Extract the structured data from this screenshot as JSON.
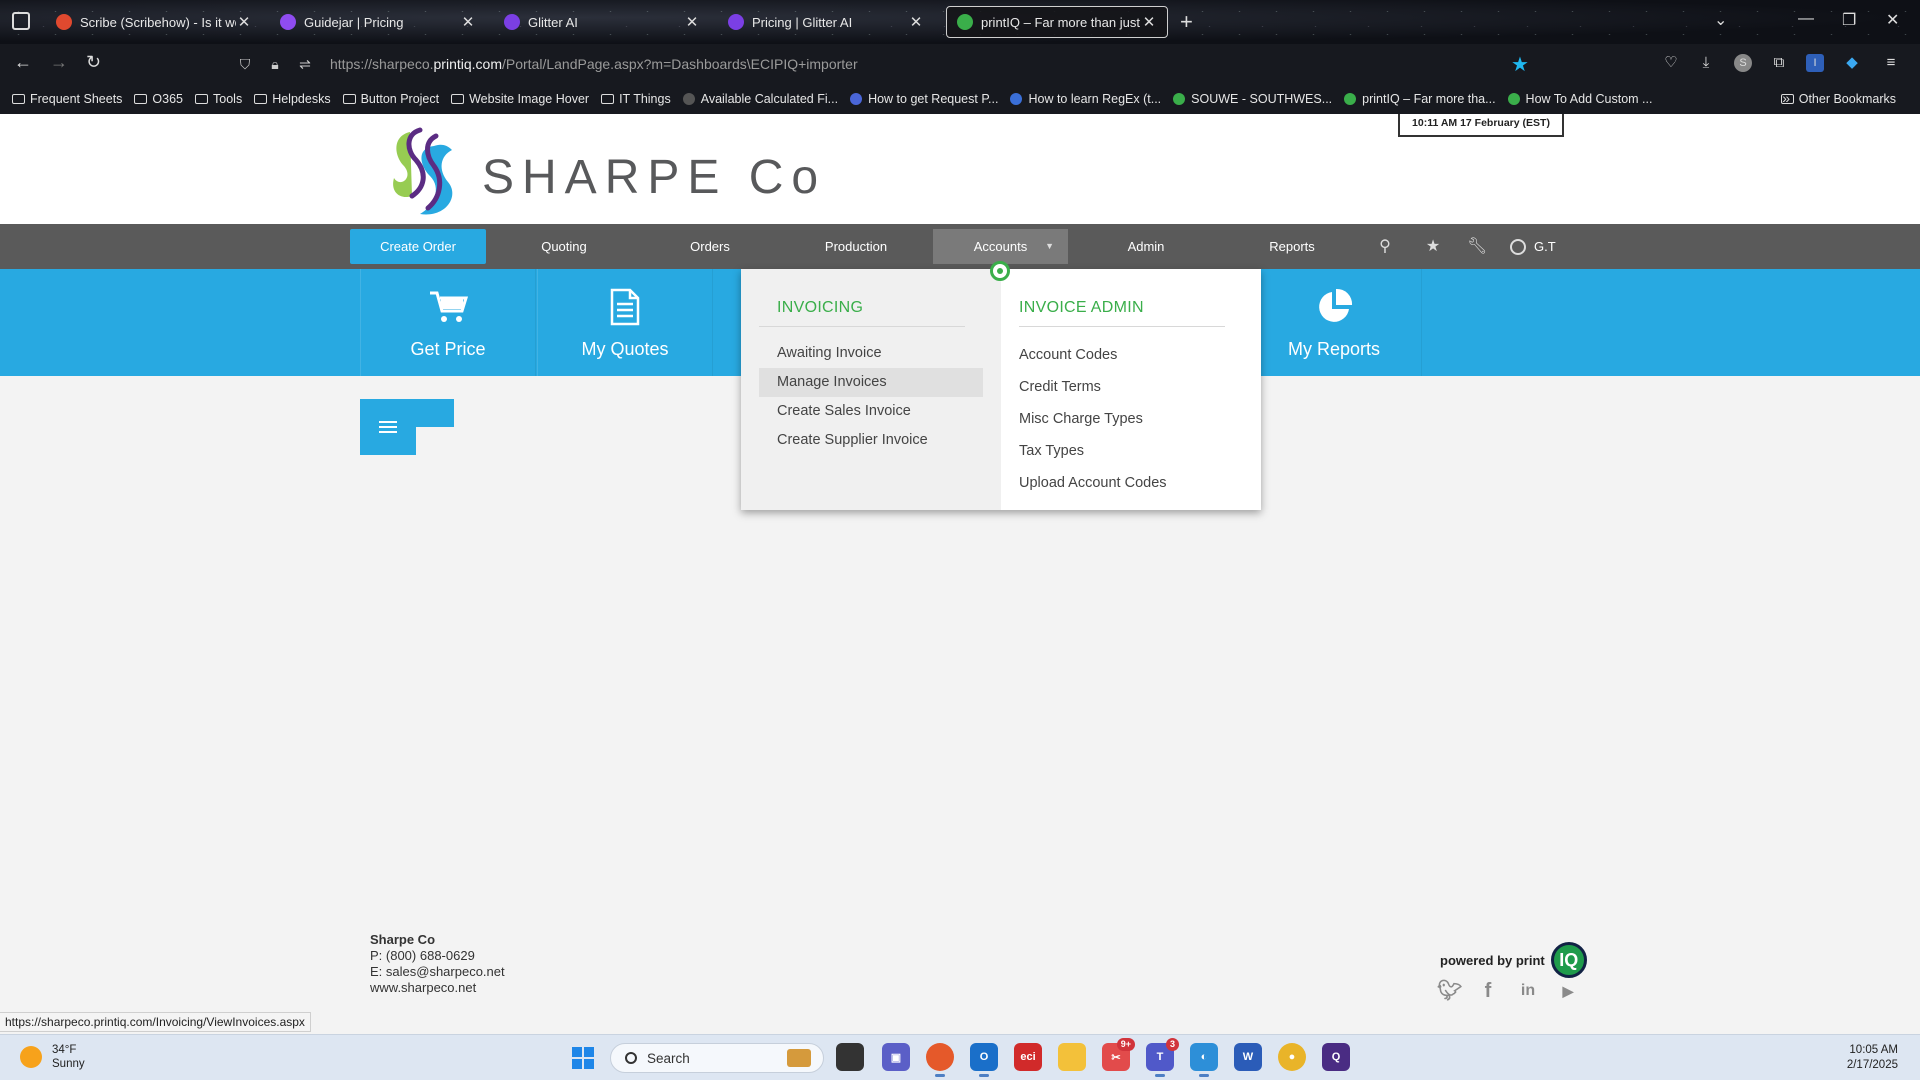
{
  "browser": {
    "tabs": [
      {
        "title": "Scribe (Scribehow) - Is it worth",
        "favicon_color": "#e0492f",
        "active": false
      },
      {
        "title": "Guidejar | Pricing",
        "favicon_color": "#8f4cf0",
        "active": false
      },
      {
        "title": "Glitter AI",
        "favicon_color": "#7b3fe4",
        "active": false
      },
      {
        "title": "Pricing | Glitter AI",
        "favicon_color": "#7b3fe4",
        "active": false
      },
      {
        "title": "printIQ – Far more than just an",
        "favicon_color": "#3aae4a",
        "active": true
      }
    ],
    "url_prefix": "https://sharpeco.",
    "url_domain": "printiq.com",
    "url_path": "/Portal/LandPage.aspx?m=Dashboards\\ECIPIQ+importer",
    "bookmarks": [
      {
        "label": "Frequent Sheets",
        "type": "folder"
      },
      {
        "label": "O365",
        "type": "folder"
      },
      {
        "label": "Tools",
        "type": "folder"
      },
      {
        "label": "Helpdesks",
        "type": "folder"
      },
      {
        "label": "Button Project",
        "type": "folder"
      },
      {
        "label": "Website Image Hover",
        "type": "folder"
      },
      {
        "label": "IT Things",
        "type": "folder"
      },
      {
        "label": "Available Calculated Fi...",
        "type": "link",
        "color": "#555"
      },
      {
        "label": "How to get Request P...",
        "type": "link",
        "color": "#4a66d8"
      },
      {
        "label": "How to learn RegEx (t...",
        "type": "link",
        "color": "#3a6fd8"
      },
      {
        "label": "SOUWE - SOUTHWES...",
        "type": "link",
        "color": "#3aae4a"
      },
      {
        "label": "printIQ – Far more tha...",
        "type": "link",
        "color": "#3aae4a"
      },
      {
        "label": "How To Add Custom ...",
        "type": "link",
        "color": "#3aae4a"
      }
    ],
    "other_bookmarks": "Other Bookmarks"
  },
  "header": {
    "clock": "10:11 AM  17 February (EST)",
    "logo_text": "SHARPE Co"
  },
  "nav": {
    "items": [
      "Create Order",
      "Quoting",
      "Orders",
      "Production",
      "Accounts",
      "Admin",
      "Reports"
    ],
    "user": "G.T"
  },
  "tiles": [
    {
      "label": "Get Price",
      "icon": "cart-icon"
    },
    {
      "label": "My Quotes",
      "icon": "document-icon"
    },
    {
      "label": "My Reports",
      "icon": "pie-chart-icon"
    }
  ],
  "dropdown": {
    "invoicing": {
      "heading": "INVOICING",
      "items": [
        "Awaiting Invoice",
        "Manage Invoices",
        "Create Sales Invoice",
        "Create Supplier Invoice"
      ],
      "hover_index": 1
    },
    "invoice_admin": {
      "heading": "INVOICE ADMIN",
      "items": [
        "Account Codes",
        "Credit Terms",
        "Misc Charge Types",
        "Tax Types",
        "Upload Account Codes"
      ]
    }
  },
  "footer": {
    "company": "Sharpe Co",
    "phone": "P: (800) 688-0629",
    "email": "E: sales@sharpeco.net",
    "web": "www.sharpeco.net",
    "powered_by": "powered by print",
    "iq": "IQ",
    "status_url": "https://sharpeco.printiq.com/Invoicing/ViewInvoices.aspx"
  },
  "taskbar": {
    "weather_temp": "34°F",
    "weather_desc": "Sunny",
    "search_placeholder": "Search",
    "time": "10:05 AM",
    "date": "2/17/2025",
    "teams_badge": "3",
    "extra_badge": "9+"
  },
  "colors": {
    "accent_blue": "#28a9e1",
    "accent_green": "#3aae4a",
    "nav_gray": "#5a5a5a"
  }
}
